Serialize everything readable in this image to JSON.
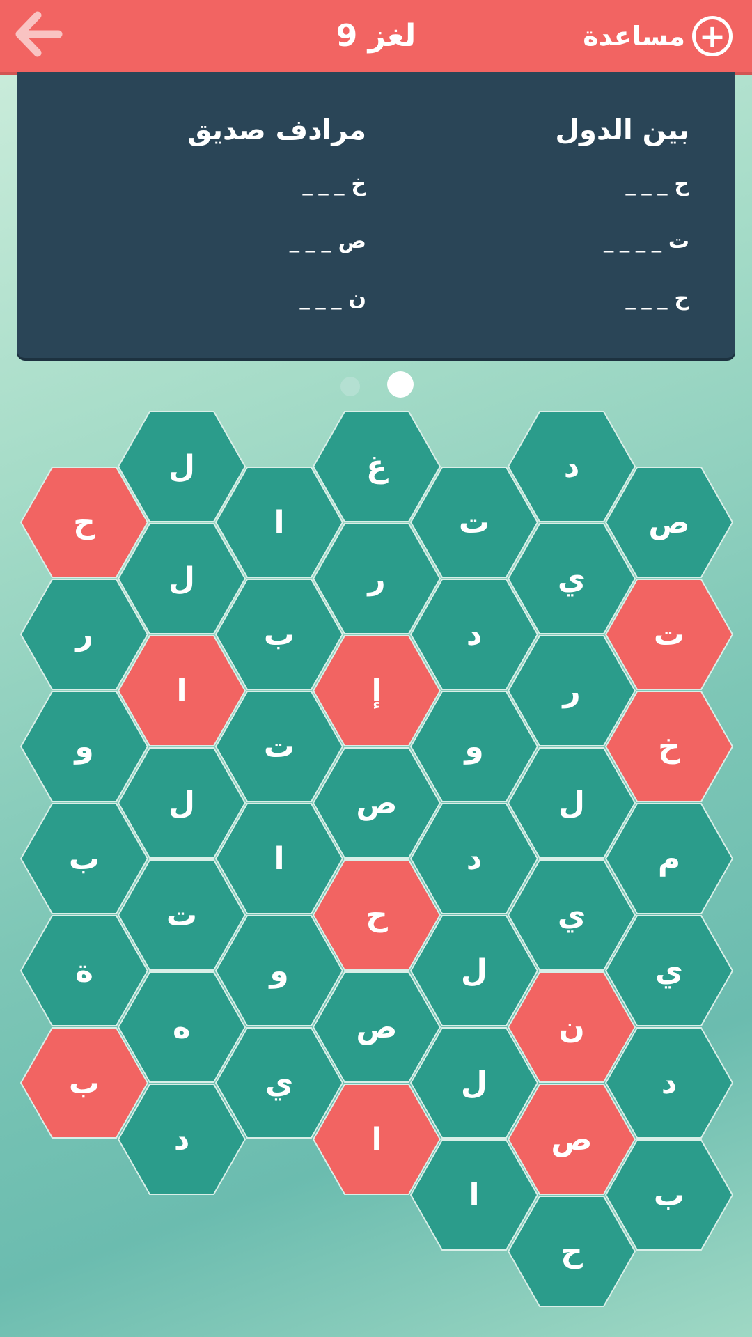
{
  "header": {
    "title": "لغز 9",
    "help_label": "مساعدة",
    "help_icon": "plus-circle-icon",
    "back_icon": "arrow-left-icon"
  },
  "clues": [
    {
      "title": "بين الدول",
      "slots": [
        {
          "letter": "ح",
          "blank": "_ _ _"
        },
        {
          "letter": "ت",
          "blank": "_ _ _ _"
        },
        {
          "letter": "ح",
          "blank": "_ _ _"
        }
      ]
    },
    {
      "title": "مرادف صديق",
      "slots": [
        {
          "letter": "خ",
          "blank": "_ _ _"
        },
        {
          "letter": "ص",
          "blank": "_ _ _"
        },
        {
          "letter": "ن",
          "blank": "_ _ _"
        }
      ]
    }
  ],
  "pagination": {
    "total": 2,
    "active": 2
  },
  "colors": {
    "accent": "#f26462",
    "panel": "#2a4557",
    "tile": "#2b9c8b",
    "tile_selected": "#f26462"
  },
  "board": {
    "columns": [
      {
        "col": 1,
        "tiles": [
          {
            "letter": "ح",
            "selected": true
          },
          {
            "letter": "ر",
            "selected": false
          },
          {
            "letter": "و",
            "selected": false
          },
          {
            "letter": "ب",
            "selected": false
          },
          {
            "letter": "ة",
            "selected": false
          },
          {
            "letter": "ب",
            "selected": true
          }
        ]
      },
      {
        "col": 2,
        "tiles": [
          {
            "letter": "ل",
            "selected": false
          },
          {
            "letter": "ل",
            "selected": false
          },
          {
            "letter": "ا",
            "selected": true
          },
          {
            "letter": "ل",
            "selected": false
          },
          {
            "letter": "ت",
            "selected": false
          },
          {
            "letter": "ه",
            "selected": false
          },
          {
            "letter": "د",
            "selected": false
          }
        ]
      },
      {
        "col": 3,
        "tiles": [
          {
            "letter": "ا",
            "selected": false
          },
          {
            "letter": "ب",
            "selected": false
          },
          {
            "letter": "ت",
            "selected": false
          },
          {
            "letter": "ا",
            "selected": false
          },
          {
            "letter": "و",
            "selected": false
          },
          {
            "letter": "ي",
            "selected": false
          }
        ]
      },
      {
        "col": 4,
        "tiles": [
          {
            "letter": "غ",
            "selected": false
          },
          {
            "letter": "ر",
            "selected": false
          },
          {
            "letter": "إ",
            "selected": true
          },
          {
            "letter": "ص",
            "selected": false
          },
          {
            "letter": "ح",
            "selected": true
          },
          {
            "letter": "ص",
            "selected": false
          },
          {
            "letter": "ا",
            "selected": true
          }
        ]
      },
      {
        "col": 5,
        "tiles": [
          {
            "letter": "ت",
            "selected": false
          },
          {
            "letter": "د",
            "selected": false
          },
          {
            "letter": "و",
            "selected": false
          },
          {
            "letter": "د",
            "selected": false
          },
          {
            "letter": "ل",
            "selected": false
          },
          {
            "letter": "ل",
            "selected": false
          },
          {
            "letter": "ا",
            "selected": false
          }
        ]
      },
      {
        "col": 6,
        "tiles": [
          {
            "letter": "د",
            "selected": false
          },
          {
            "letter": "ي",
            "selected": false
          },
          {
            "letter": "ر",
            "selected": false
          },
          {
            "letter": "ل",
            "selected": false
          },
          {
            "letter": "ي",
            "selected": false
          },
          {
            "letter": "ن",
            "selected": true
          },
          {
            "letter": "ص",
            "selected": true
          },
          {
            "letter": "ح",
            "selected": false
          }
        ]
      },
      {
        "col": 7,
        "tiles": [
          {
            "letter": "ص",
            "selected": false
          },
          {
            "letter": "ت",
            "selected": true
          },
          {
            "letter": "خ",
            "selected": true
          },
          {
            "letter": "م",
            "selected": false
          },
          {
            "letter": "ي",
            "selected": false
          },
          {
            "letter": "د",
            "selected": false
          },
          {
            "letter": "ب",
            "selected": false
          }
        ]
      }
    ]
  }
}
